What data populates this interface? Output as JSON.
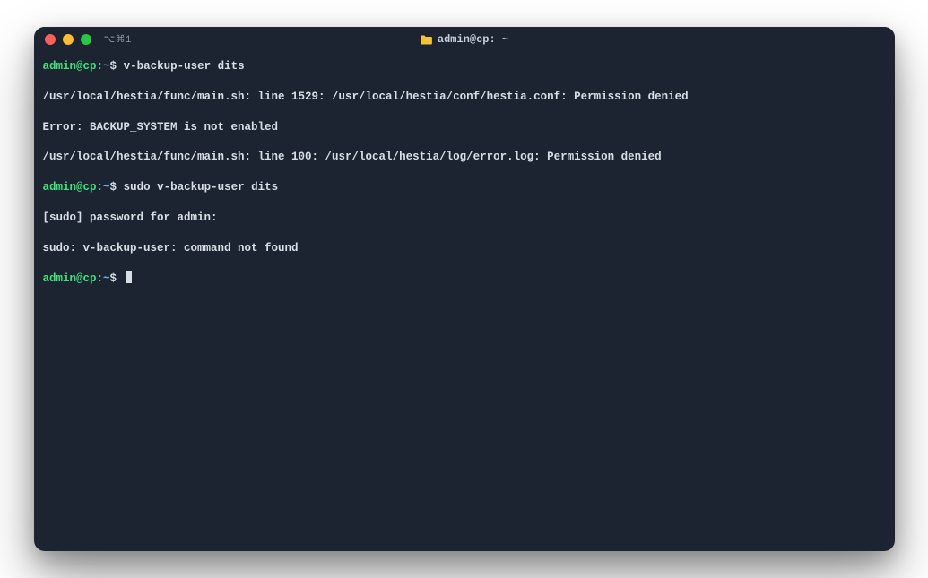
{
  "window": {
    "tab_label": "⌥⌘1",
    "title": "admin@cp: ~"
  },
  "colors": {
    "bg": "#1b2430",
    "text": "#d7dee5",
    "prompt_user": "#3fe37a",
    "prompt_path": "#59b7ff",
    "traffic_red": "#ff5f57",
    "traffic_yellow": "#febc2e",
    "traffic_green": "#28c840",
    "folder_icon": "#f4c430"
  },
  "prompt": {
    "user_host": "admin@cp",
    "colon": ":",
    "path": "~",
    "symbol": "$"
  },
  "session": {
    "lines": [
      {
        "type": "prompt",
        "command": "v-backup-user dits"
      },
      {
        "type": "output",
        "text": "/usr/local/hestia/func/main.sh: line 1529: /usr/local/hestia/conf/hestia.conf: Permission denied"
      },
      {
        "type": "output",
        "text": "Error: BACKUP_SYSTEM is not enabled"
      },
      {
        "type": "output",
        "text": "/usr/local/hestia/func/main.sh: line 100: /usr/local/hestia/log/error.log: Permission denied"
      },
      {
        "type": "prompt",
        "command": "sudo v-backup-user dits"
      },
      {
        "type": "output",
        "text": "[sudo] password for admin:"
      },
      {
        "type": "output",
        "text": "sudo: v-backup-user: command not found"
      },
      {
        "type": "prompt",
        "command": "",
        "cursor": true
      }
    ]
  }
}
